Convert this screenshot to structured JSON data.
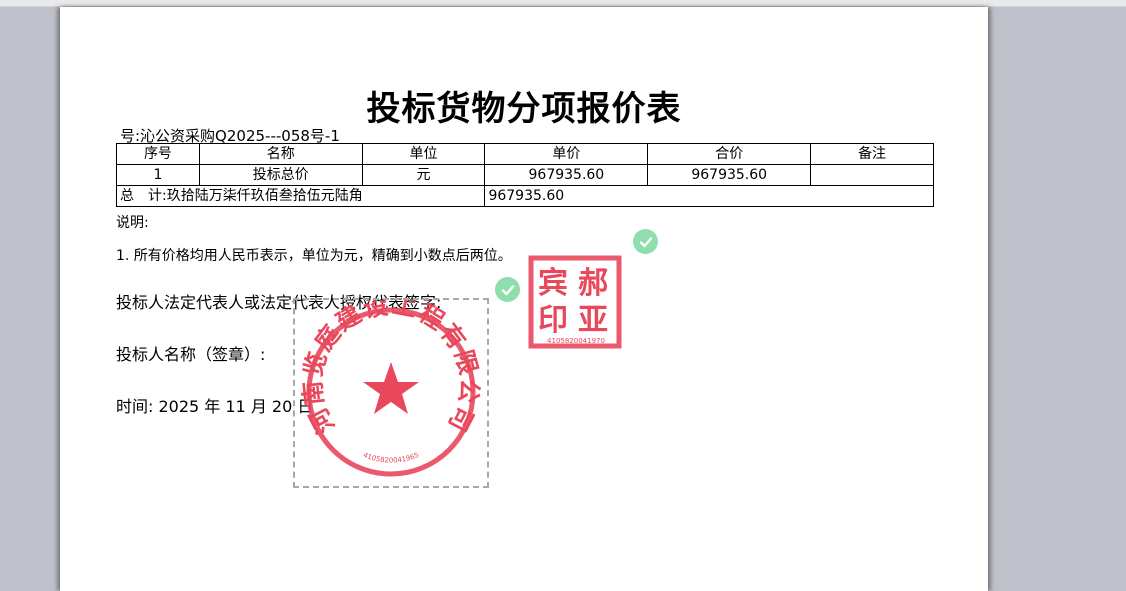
{
  "doc": {
    "title": "投标货物分项报价表",
    "project_no": "号:沁公资采购Q2025---058号-1"
  },
  "table": {
    "headers": [
      "序号",
      "名称",
      "单位",
      "单价",
      "合价",
      "备注"
    ],
    "rows": [
      [
        "1",
        "投标总价",
        "元",
        "967935.60",
        "967935.60",
        ""
      ]
    ],
    "total_label": "总　计:玖拾陆万柒仟玖佰叁拾伍元陆角",
    "total_value": "967935.60"
  },
  "notes": {
    "heading": "说明:",
    "item1": "1.  所有价格均用人民币表示，单位为元，精确到小数点后两位。"
  },
  "fields": {
    "signature": "投标人法定代表人或法定代表人授权代表签字:",
    "company_seal": "投标人名称（签章）:",
    "date": "时间:  2025 年 11 月 20 日"
  },
  "seals": {
    "square_text": [
      "宾",
      "郝",
      "印",
      "亚"
    ],
    "square_code": "4105820041970",
    "round_text": "河南览庭建设工程有限公司",
    "round_code": "4105820041965"
  },
  "icons": [
    "check-circle-icon",
    "star-icon"
  ],
  "colors": {
    "seal_red": "#e8475c",
    "check_green": "#8fdfae",
    "viewer_bg": "#bfc1ca"
  }
}
